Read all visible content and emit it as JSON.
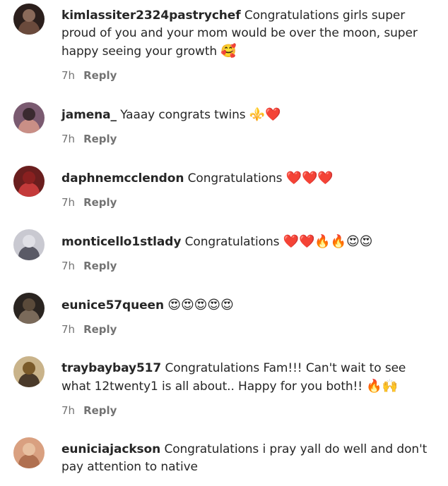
{
  "comments": [
    {
      "username": "kimlassiter2324pastrychef",
      "text": "Congratulations girls super proud of you and your mom would be over the moon, super happy seeing your growth",
      "emoji": "🥰",
      "time": "7h",
      "reply_label": "Reply",
      "avatar_colors": [
        "#2b1f1c",
        "#6a4a3c",
        "#8a6a5a"
      ]
    },
    {
      "username": "jamena_",
      "text": "Yaaay congrats twins",
      "emoji": "⚜️❤️",
      "time": "7h",
      "reply_label": "Reply",
      "avatar_colors": [
        "#7a5a70",
        "#c98f86",
        "#3a2a30"
      ]
    },
    {
      "username": "daphnemcclendon",
      "text": "Congratulations",
      "emoji": "❤️❤️❤️",
      "time": "7h",
      "reply_label": "Reply",
      "avatar_colors": [
        "#6a1e1e",
        "#c43a3a",
        "#8a2020"
      ]
    },
    {
      "username": "monticello1stlady",
      "text": "Congratulations",
      "emoji": "❤️❤️🔥🔥😍😍",
      "time": "7h",
      "reply_label": "Reply",
      "avatar_colors": [
        "#c9c9d1",
        "#5a5a66",
        "#e0e0e6"
      ]
    },
    {
      "username": "eunice57queen",
      "text": "",
      "emoji": "😍😍😍😍😍",
      "time": "7h",
      "reply_label": "Reply",
      "avatar_colors": [
        "#2a2420",
        "#7a6a5a",
        "#5a4a3a"
      ]
    },
    {
      "username": "traybaybay517",
      "text": "Congratulations Fam!!! Can't wait to see what 12twenty1 is all about.. Happy for you both!!",
      "emoji": "🔥🙌",
      "time": "7h",
      "reply_label": "Reply",
      "avatar_colors": [
        "#c9b38a",
        "#4a3a2a",
        "#7a5a2a"
      ]
    },
    {
      "username": "euniciajackson",
      "text": "Congratulations i pray yall do well and don't pay attention to native",
      "emoji": "",
      "time": "",
      "reply_label": "",
      "avatar_colors": [
        "#d9a080",
        "#b07050",
        "#e8c0a0"
      ]
    }
  ]
}
